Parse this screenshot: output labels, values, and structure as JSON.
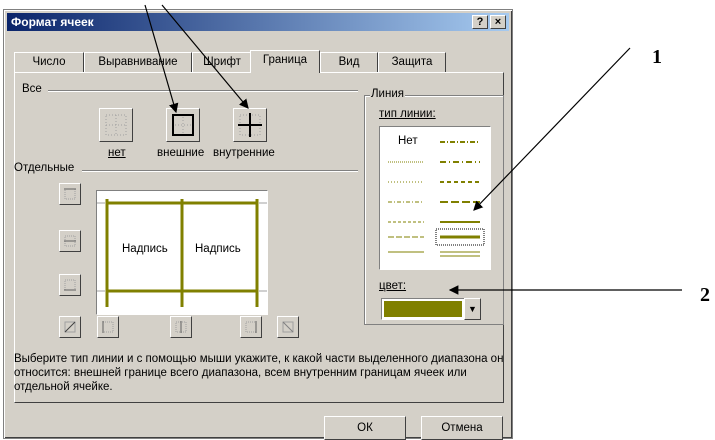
{
  "window": {
    "title": "Формат ячеек",
    "help_button": "?",
    "close_button": "×"
  },
  "tabs": [
    {
      "label": "Число"
    },
    {
      "label": "Выравнивание"
    },
    {
      "label": "Шрифт"
    },
    {
      "label": "Граница",
      "active": true
    },
    {
      "label": "Вид"
    },
    {
      "label": "Защита"
    }
  ],
  "presets": {
    "group_label": "Все",
    "none_label": "нет",
    "outline_label": "внешние",
    "inside_label": "внутренние"
  },
  "border_group_label": "Отдельные",
  "preview": {
    "cell1": "Надпись",
    "cell2": "Надпись"
  },
  "line": {
    "group_label": "Линия",
    "style_label": "тип линии:",
    "none_option": "Нет",
    "color_label": "цвет:",
    "selected_color": "#808000"
  },
  "description": "Выберите тип линии и с помощью мыши укажите, к какой части выделенного диапазона он относится: внешней границе всего диапазона, всем внутренним границам ячеек или отдельной ячейке.",
  "buttons": {
    "ok": "ОК",
    "cancel": "Отмена"
  },
  "annotations": {
    "label1": "1",
    "label2": "2"
  }
}
